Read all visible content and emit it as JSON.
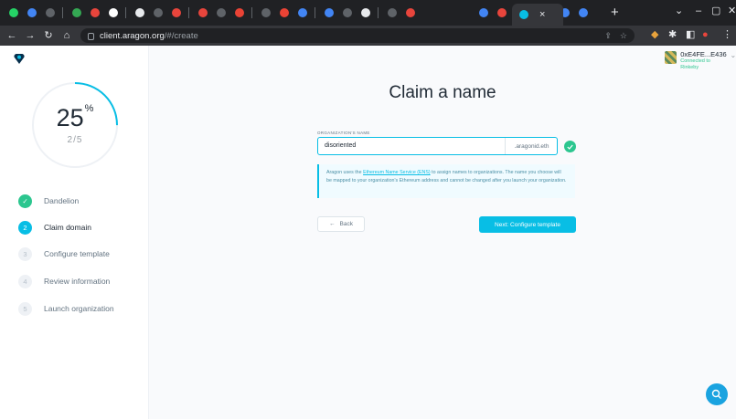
{
  "browser": {
    "tab_icons": [
      "#25d366",
      "#4285f4",
      "#5f6368",
      "#34a853",
      "#e8453c",
      "#ffffff",
      "#e8eaed",
      "#5f6368",
      "#e8453c",
      "#e8453c",
      "#5f6368",
      "#ea4335",
      "#5f6368",
      "#ea4335",
      "#4285f4",
      "#4285f4",
      "#5f6368",
      "#e8eaed",
      "#5f6368",
      "#e8453c",
      "#ffffff",
      "#4285f4",
      "#e8453c",
      "#5f6368",
      "#5f6368",
      "#4285f4",
      "#4285f4"
    ],
    "close_tab": "×",
    "new_tab": "+",
    "url_host": "client.aragon.org",
    "url_path": "/#/create",
    "window_controls": [
      "⌄",
      "–",
      "▢",
      "✕"
    ]
  },
  "account": {
    "address": "0xE4FE...E436",
    "network": "Connected to Rinkeby"
  },
  "sidebar": {
    "progress_value": "25",
    "progress_unit": "%",
    "progress_fraction": 0.25,
    "steps_count": "2/5",
    "steps": [
      {
        "number": "✓",
        "label": "Dandelion",
        "state": "done"
      },
      {
        "number": "2",
        "label": "Claim domain",
        "state": "active"
      },
      {
        "number": "3",
        "label": "Configure template",
        "state": "pending"
      },
      {
        "number": "4",
        "label": "Review information",
        "state": "pending"
      },
      {
        "number": "5",
        "label": "Launch organization",
        "state": "pending"
      }
    ]
  },
  "main": {
    "title": "Claim a name",
    "field_label": "ORGANIZATION'S NAME",
    "field_value": "disoriented",
    "field_suffix": ".aragonid.eth",
    "info_pre": "Aragon uses the ",
    "info_link": "Ethereum Name Service (ENS)",
    "info_post": " to assign names to organizations. The name you choose will be mapped to your organization's Ethereum address and cannot be changed after you launch your organization.",
    "back_label": "Back",
    "back_icon": "←",
    "next_label": "Next: Configure template"
  },
  "colors": {
    "accent": "#08bee5",
    "success": "#2cc68f",
    "help_button": "#1aa3e0"
  }
}
